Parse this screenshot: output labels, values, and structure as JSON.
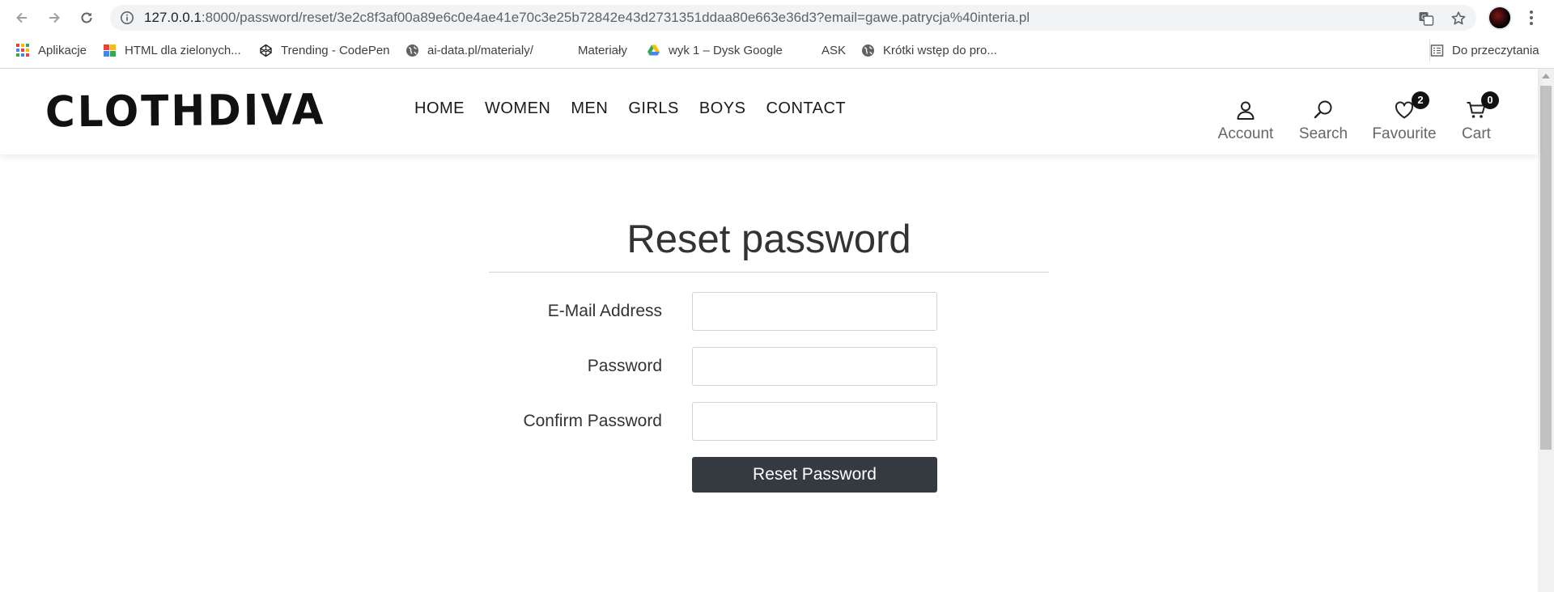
{
  "browser": {
    "url_host": "127.0.0.1",
    "url_rest": ":8000/password/reset/3e2c8f3af00a89e6c0e4ae41e70c3e25b72842e43d2731351ddaa80e663e36d3?email=gawe.patrycja%40interia.pl",
    "bookmarks": [
      {
        "label": "Aplikacje",
        "icon": "apps-grid-icon"
      },
      {
        "label": "HTML dla zielonych...",
        "icon": "html-bookmark-icon"
      },
      {
        "label": "Trending - CodePen",
        "icon": "codepen-icon"
      },
      {
        "label": "ai-data.pl/materialy/",
        "icon": "globe-icon"
      },
      {
        "label": "Materiały",
        "icon": "none"
      },
      {
        "label": "wyk 1 – Dysk Google",
        "icon": "google-drive-icon"
      },
      {
        "label": "ASK",
        "icon": "none"
      },
      {
        "label": "Krótki wstęp do pro...",
        "icon": "globe-icon"
      }
    ],
    "reading_list": "Do przeczytania"
  },
  "site": {
    "logo": "CLOTHDIVA",
    "nav": [
      "HOME",
      "WOMEN",
      "MEN",
      "GIRLS",
      "BOYS",
      "CONTACT"
    ],
    "icons": {
      "account": "Account",
      "search": "Search",
      "favourite": "Favourite",
      "favourite_count": "2",
      "cart": "Cart",
      "cart_count": "0"
    }
  },
  "form": {
    "title": "Reset password",
    "email_label": "E-Mail Address",
    "email_value": "",
    "password_label": "Password",
    "password_value": "",
    "confirm_label": "Confirm Password",
    "confirm_value": "",
    "submit_label": "Reset Password"
  }
}
